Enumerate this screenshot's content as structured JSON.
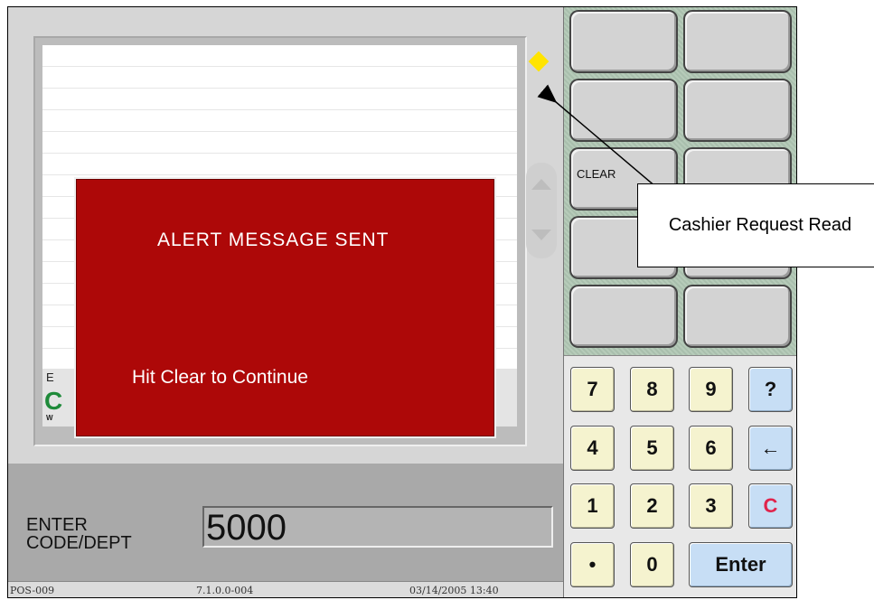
{
  "alert": {
    "title": "ALERT MESSAGE SENT",
    "hint": "Hit Clear to Continue",
    "background_color": "#ad0808"
  },
  "receipt_footer": {
    "partial_label": "E",
    "partial_large": "C",
    "partial_small": "W"
  },
  "status_indicator": {
    "icon": "yellow-diamond-icon",
    "color": "#ffe400"
  },
  "entry": {
    "label": "ENTER CODE/DEPT",
    "value": "5000"
  },
  "statusbar": {
    "terminal": "POS-009",
    "version": "7.1.0.0-004",
    "datetime": "03/14/2005 13:40"
  },
  "function_keys": {
    "clear_label": "CLEAR"
  },
  "numpad": {
    "keys": [
      "7",
      "8",
      "9",
      "?",
      "4",
      "5",
      "6",
      "←",
      "1",
      "2",
      "3",
      "C",
      "•",
      "0",
      "Enter"
    ],
    "accent_color": "#c7def5",
    "clear_color": "#e0244c"
  },
  "annotation": {
    "text": "Cashier Request Read"
  }
}
